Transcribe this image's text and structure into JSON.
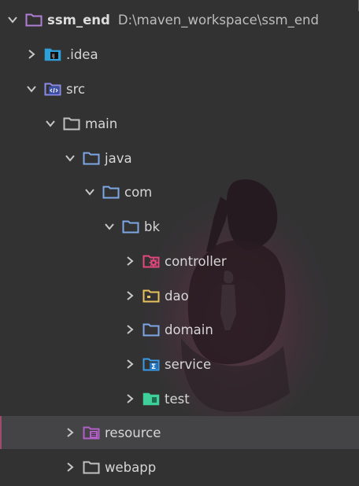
{
  "project": {
    "name": "ssm_end",
    "path": "D:\\maven_workspace\\ssm_end"
  },
  "tree": {
    "idea": {
      "label": ".idea",
      "icon": "idea-folder-icon",
      "expanded": false
    },
    "src": {
      "label": "src",
      "icon": "source-folder-icon",
      "expanded": true
    },
    "main": {
      "label": "main",
      "icon": "folder-icon",
      "expanded": true
    },
    "java": {
      "label": "java",
      "icon": "folder-icon",
      "expanded": true
    },
    "com": {
      "label": "com",
      "icon": "package-folder-icon",
      "expanded": true
    },
    "bk": {
      "label": "bk",
      "icon": "package-folder-icon",
      "expanded": true
    },
    "controller": {
      "label": "controller",
      "icon": "controller-folder-icon",
      "expanded": false
    },
    "dao": {
      "label": "dao",
      "icon": "dao-folder-icon",
      "expanded": false
    },
    "domain": {
      "label": "domain",
      "icon": "domain-folder-icon",
      "expanded": false
    },
    "service": {
      "label": "service",
      "icon": "service-folder-icon",
      "expanded": false
    },
    "test": {
      "label": "test",
      "icon": "test-folder-icon",
      "expanded": false
    },
    "resource": {
      "label": "resource",
      "icon": "resource-folder-icon",
      "expanded": false,
      "selected": true
    },
    "webapp": {
      "label": "webapp",
      "icon": "folder-icon",
      "expanded": false
    }
  },
  "colors": {
    "background": "#323233",
    "selected_row": "#444446",
    "project_folder": "#b07fd6",
    "blue_folder": "#7ea7e6",
    "grey_folder": "#c2c2c2",
    "controller": "#e2477d",
    "dao": "#e7c35c",
    "service": "#3a9be7",
    "test": "#3fcf9a",
    "resource": "#b25fc7"
  }
}
